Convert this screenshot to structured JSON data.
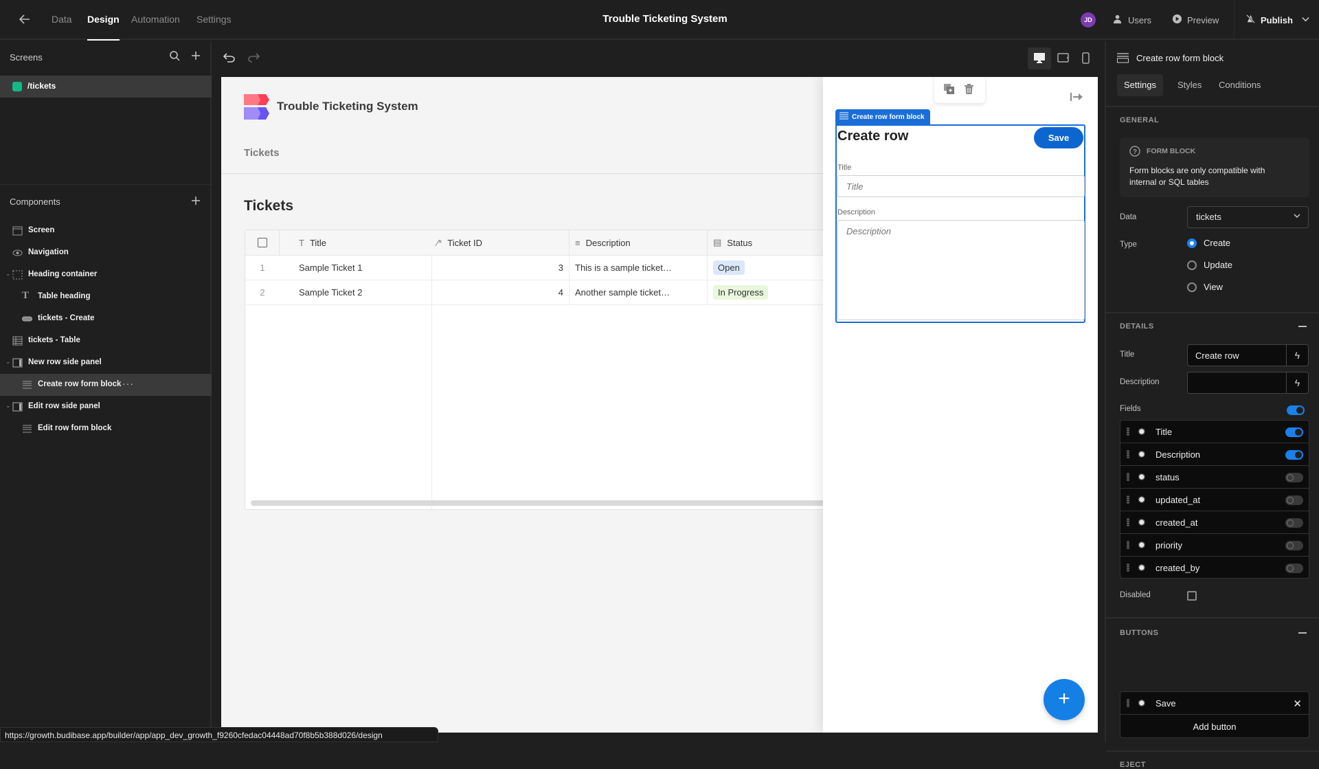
{
  "topbar": {
    "tabs": [
      "Data",
      "Design",
      "Automation",
      "Settings"
    ],
    "active_tab": "Design",
    "app_title": "Trouble Ticketing System",
    "avatar_initials": "JD",
    "users_label": "Users",
    "preview_label": "Preview",
    "publish_label": "Publish"
  },
  "sidebar": {
    "screens_title": "Screens",
    "screens": [
      {
        "route": "/tickets",
        "color": "#12b886"
      }
    ],
    "components_title": "Components",
    "components": [
      {
        "label": "Screen",
        "icon": "screen-icon",
        "level": 0
      },
      {
        "label": "Navigation",
        "icon": "navigation-icon",
        "level": 0
      },
      {
        "label": "Heading container",
        "icon": "container-icon",
        "level": 0,
        "expanded": true
      },
      {
        "label": "Table heading",
        "icon": "text-icon",
        "level": 1
      },
      {
        "label": "tickets - Create",
        "icon": "button-icon",
        "level": 1
      },
      {
        "label": "tickets - Table",
        "icon": "table-icon",
        "level": 0
      },
      {
        "label": "New row side panel",
        "icon": "side-panel-icon",
        "level": 0,
        "expanded": true
      },
      {
        "label": "Create row form block",
        "icon": "form-block-icon",
        "level": 1,
        "selected": true
      },
      {
        "label": "Edit row side panel",
        "icon": "side-panel-icon",
        "level": 0,
        "expanded": true
      },
      {
        "label": "Edit row form block",
        "icon": "form-block-icon",
        "level": 1
      }
    ]
  },
  "canvas": {
    "app_name": "Trouble Ticketing System",
    "nav_link": "Tickets",
    "heading": "Tickets",
    "table": {
      "columns": [
        {
          "label": "Title",
          "icon": "text-type-icon"
        },
        {
          "label": "Ticket ID",
          "icon": "auto-id-icon"
        },
        {
          "label": "Description",
          "icon": "longform-icon"
        },
        {
          "label": "Status",
          "icon": "options-icon"
        }
      ],
      "rows": [
        {
          "num": "1",
          "title": "Sample Ticket 1",
          "ticket_id": "3",
          "description": "This is a sample ticket…",
          "status": "Open",
          "status_bg": "#dbe7fb"
        },
        {
          "num": "2",
          "title": "Sample Ticket 2",
          "ticket_id": "4",
          "description": "Another sample ticket…",
          "status": "In Progress",
          "status_bg": "#e9f7dc"
        }
      ]
    },
    "side_panel": {
      "block_tag": "Create row form block",
      "form_title": "Create row",
      "save_label": "Save",
      "fields": [
        {
          "label": "Title",
          "placeholder": "Title"
        },
        {
          "label": "Description",
          "placeholder": "Description"
        }
      ]
    }
  },
  "settings": {
    "component_name": "Create row form block",
    "tabs": [
      "Settings",
      "Styles",
      "Conditions"
    ],
    "active_tab": "Settings",
    "general": {
      "section_title": "GENERAL",
      "info_title": "FORM BLOCK",
      "info_text": "Form blocks are only compatible with internal or SQL tables",
      "data_label": "Data",
      "data_value": "tickets",
      "type_label": "Type",
      "type_options": [
        "Create",
        "Update",
        "View"
      ],
      "type_selected": "Create"
    },
    "details": {
      "section_title": "DETAILS",
      "title_label": "Title",
      "title_value": "Create row",
      "description_label": "Description",
      "description_value": "",
      "fields_label": "Fields",
      "fields_enabled": true,
      "fields": [
        {
          "name": "Title",
          "enabled": true
        },
        {
          "name": "Description",
          "enabled": true
        },
        {
          "name": "status",
          "enabled": false
        },
        {
          "name": "updated_at",
          "enabled": false
        },
        {
          "name": "created_at",
          "enabled": false
        },
        {
          "name": "priority",
          "enabled": false
        },
        {
          "name": "created_by",
          "enabled": false
        }
      ],
      "disabled_label": "Disabled",
      "disabled_checked": false
    },
    "buttons": {
      "section_title": "BUTTONS",
      "items": [
        "Save"
      ],
      "add_label": "Add button"
    },
    "eject": {
      "section_title": "EJECT"
    }
  },
  "statusbar": {
    "url": "https://growth.budibase.app/builder/app/app_dev_growth_f9260cfedac04448ad70f8b5b388d026/design"
  }
}
